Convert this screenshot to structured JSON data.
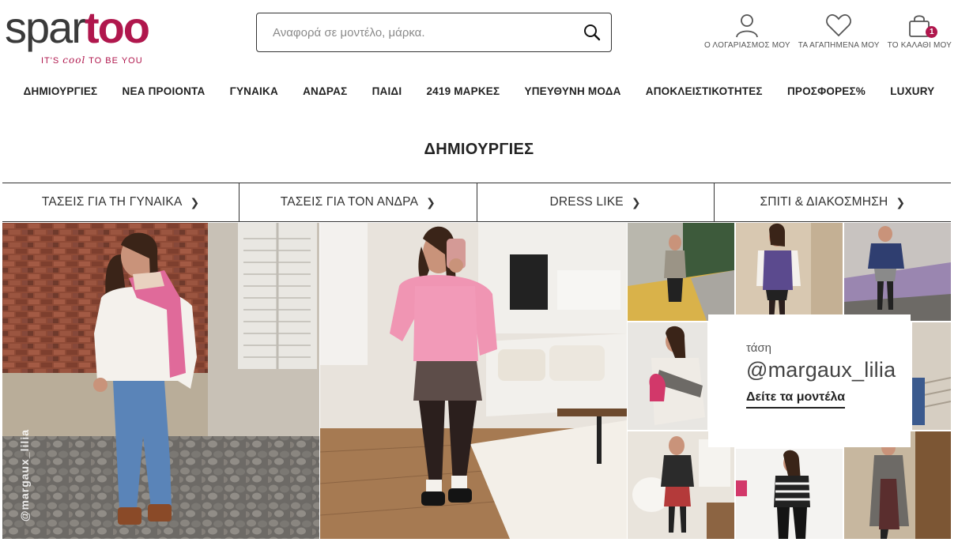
{
  "brand": {
    "name_part1": "spar",
    "name_part2": "too",
    "tagline_pre": "IT'S ",
    "tagline_cool": "cool",
    "tagline_post": " TO BE YOU",
    "accent_color": "#b0174d"
  },
  "search": {
    "placeholder": "Αναφορά σε μοντέλο, μάρκα.",
    "icon": "search-icon"
  },
  "header_links": [
    {
      "label": "Ο ΛΟΓΑΡΙΑΣΜΟΣ ΜΟΥ",
      "icon": "user-icon"
    },
    {
      "label": "ΤΑ ΑΓΑΠΗΜΕΝΑ ΜΟΥ",
      "icon": "heart-icon"
    },
    {
      "label": "ΤΟ ΚΑΛΑΘΙ ΜΟΥ",
      "icon": "cart-icon",
      "badge": "1"
    }
  ],
  "nav": [
    "ΔΗΜΙΟΥΡΓΙΕΣ",
    "ΝΕΑ ΠΡΟΙΟΝΤΑ",
    "ΓΥΝΑΙΚΑ",
    "ΑΝΔΡΑΣ",
    "ΠΑΙΔΙ",
    "2419 ΜΑΡΚΕΣ",
    "ΥΠΕΥΘΥΝΗ ΜΟΔΑ",
    "ΑΠΟΚΛΕΙΣΤΙΚΟΤΗΤΕΣ",
    "ΠΡΟΣΦΟΡΕΣ%",
    "LUXURY"
  ],
  "section_title": "ΔΗΜΙΟΥΡΓΙΕΣ",
  "categories": [
    "ΤΑΣΕΙΣ ΓΙΑ ΤΗ ΓΥΝΑΙΚΑ",
    "ΤΑΣΕΙΣ ΓΙΑ ΤΟΝ ΑΝΔΡΑ",
    "DRESS LIKE",
    "ΣΠΙΤΙ & ΔΙΑΚΟΣΜΗΣΗ"
  ],
  "gallery": {
    "watermark": "@margaux_lilia"
  },
  "promo": {
    "kicker": "τάση",
    "title": "@margaux_lilia",
    "link": "Δείτε τα μοντέλα"
  }
}
